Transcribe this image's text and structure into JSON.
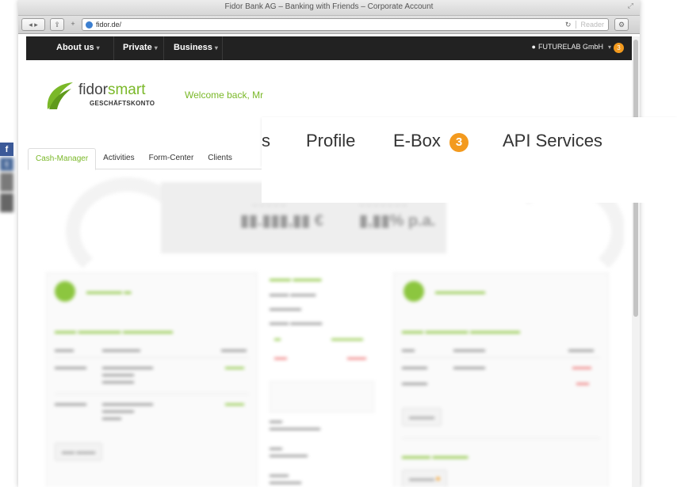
{
  "window": {
    "title": "Fidor Bank AG – Banking with Friends – Corporate Account"
  },
  "browser": {
    "url": "fidor.de/",
    "reader_label": "Reader"
  },
  "nav": {
    "items": [
      {
        "label": "About us"
      },
      {
        "label": "Private"
      },
      {
        "label": "Business"
      }
    ],
    "user_label": "FUTURELAB GmbH",
    "badge": "3"
  },
  "brand": {
    "name_part1": "fidor",
    "name_part2": "smart",
    "subtitle": "GESCHÄFTSKONTO",
    "welcome": "Welcome back, Mr"
  },
  "tabs": [
    {
      "label": "Cash-Manager"
    },
    {
      "label": "Activities"
    },
    {
      "label": "Form-Center"
    },
    {
      "label": "Clients"
    }
  ],
  "overlay_menu": {
    "items": [
      {
        "label": "s"
      },
      {
        "label": "Profile"
      },
      {
        "label": "E-Box"
      },
      {
        "label": "API Services"
      }
    ],
    "ebox_badge": "3"
  },
  "colors": {
    "accent": "#7ab828",
    "navbar": "#222222",
    "badge": "#f39a1e"
  },
  "social": [
    {
      "icon": "facebook-icon",
      "glyph": "f",
      "color": "#3b5998"
    },
    {
      "icon": "twitter-icon",
      "glyph": "t",
      "color": "#4a6a9a"
    },
    {
      "icon": "share-icon",
      "glyph": "",
      "color": "#6a6a6a"
    },
    {
      "icon": "share-icon",
      "glyph": "",
      "color": "#555"
    }
  ]
}
